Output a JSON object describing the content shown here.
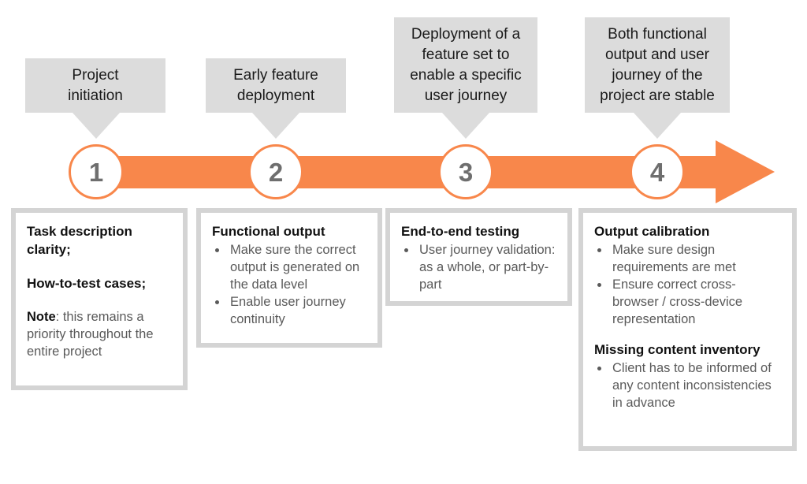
{
  "theme": {
    "accent": "#f8874b",
    "callout_bg": "#dcdcdc",
    "box_border": "#d4d4d4",
    "number_color": "#6e6e6e",
    "body_text": "#5a5a5a",
    "heading_text": "#111111"
  },
  "milestones": [
    {
      "number": "1",
      "callout": "Project\ninitiation"
    },
    {
      "number": "2",
      "callout": "Early feature\ndeployment"
    },
    {
      "number": "3",
      "callout": "Deployment of a\nfeature set to\nenable a specific\nuser journey"
    },
    {
      "number": "4",
      "callout": "Both functional\noutput and user\njourney of the\nproject are stable"
    }
  ],
  "details": {
    "box1": {
      "line1": "Task description clarity;",
      "line2": "How-to-test cases;",
      "note_label": "Note",
      "note_text": ": this remains a priority throughout the entire project"
    },
    "box2": {
      "title": "Functional output",
      "bullets": [
        "Make sure the correct output is generated on the data level",
        "Enable user journey continuity"
      ]
    },
    "box3": {
      "title": "End-to-end testing",
      "bullets": [
        "User journey validation: as a whole, or part-by-part"
      ]
    },
    "box4": {
      "title_a": "Output calibration",
      "bullets_a": [
        "Make sure design requirements are met",
        "Ensure correct cross-browser / cross-device representation"
      ],
      "title_b": "Missing content inventory",
      "bullets_b": [
        "Client has to be informed of any content inconsistencies in advance"
      ]
    }
  }
}
